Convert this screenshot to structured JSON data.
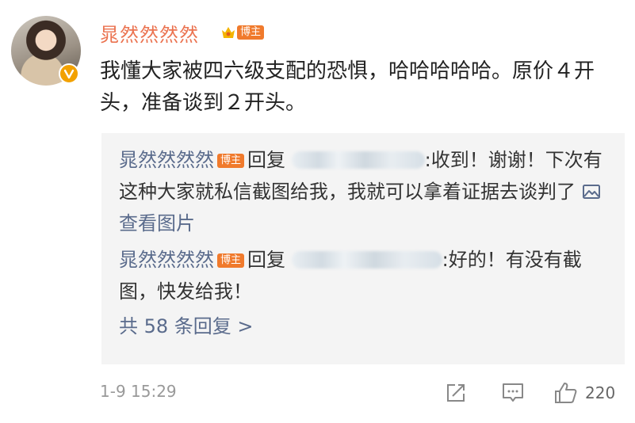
{
  "post": {
    "author": "晁然然然然",
    "badge": "博主",
    "text": "我懂大家被四六级支配的恐惧，哈哈哈哈哈。原价４开头，准备谈到２开头。",
    "timestamp": "1-9 15:29",
    "like_count": "220"
  },
  "replies": [
    {
      "name": "晁然然然然",
      "badge": "博主",
      "reply_word": "回复",
      "text": ":收到！谢谢！下次有这种大家就私信截图给我，我就可以拿着证据去谈判了",
      "link": "查看图片"
    },
    {
      "name": "晁然然然然",
      "badge": "博主",
      "reply_word": "回复",
      "text": ":好的！有没有截图，快发给我！"
    }
  ],
  "more_replies": "共 58 条回复 >",
  "colors": {
    "author_orange": "#eb7350",
    "badge_orange": "#f07a2c",
    "link_blue": "#5a6b8c",
    "reply_bg": "#f4f4f4"
  },
  "icons": [
    "crown-icon",
    "verified-badge-icon",
    "image-icon",
    "repost-icon",
    "comment-icon",
    "like-icon"
  ]
}
